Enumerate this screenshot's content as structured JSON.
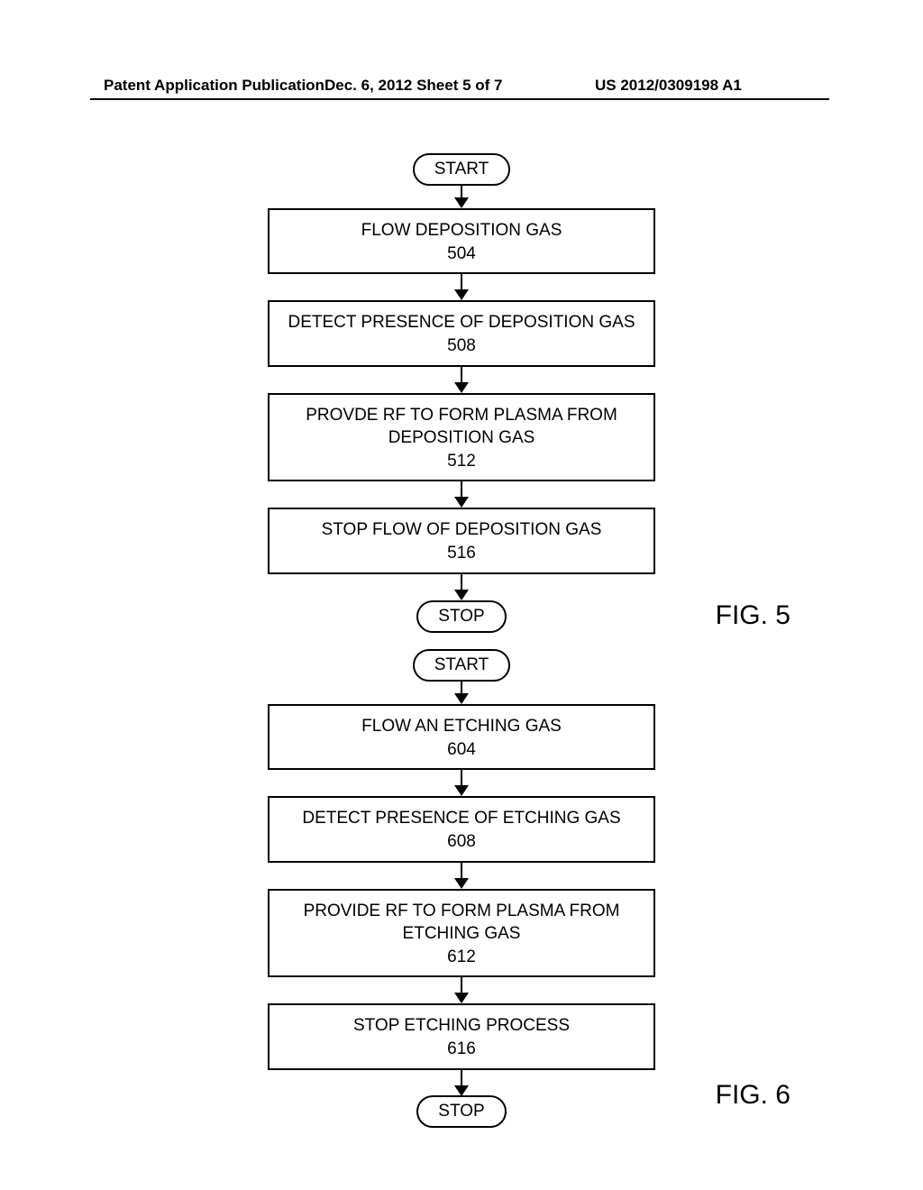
{
  "header": {
    "left": "Patent Application Publication",
    "center": "Dec. 6, 2012   Sheet 5 of 7",
    "right": "US 2012/0309198 A1"
  },
  "fig5": {
    "start": "START",
    "s504": {
      "text": "FLOW DEPOSITION GAS",
      "num": "504"
    },
    "s508": {
      "text": "DETECT PRESENCE OF DEPOSITION GAS",
      "num": "508"
    },
    "s512": {
      "text1": "PROVDE RF TO FORM PLASMA FROM",
      "text2": "DEPOSITION GAS",
      "num": "512"
    },
    "s516": {
      "text": "STOP FLOW OF DEPOSITION GAS",
      "num": "516"
    },
    "stop": "STOP",
    "label": "FIG. 5"
  },
  "fig6": {
    "start": "START",
    "s604": {
      "text": "FLOW AN ETCHING GAS",
      "num": "604"
    },
    "s608": {
      "text": "DETECT PRESENCE OF ETCHING GAS",
      "num": "608"
    },
    "s612": {
      "text1": "PROVIDE RF TO FORM PLASMA FROM",
      "text2": "ETCHING GAS",
      "num": "612"
    },
    "s616": {
      "text": "STOP ETCHING PROCESS",
      "num": "616"
    },
    "stop": "STOP",
    "label": "FIG. 6"
  }
}
